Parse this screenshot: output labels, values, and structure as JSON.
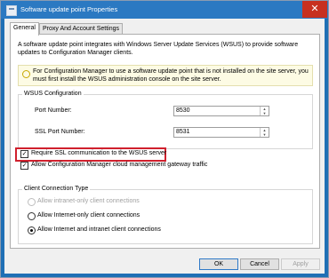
{
  "window": {
    "title": "Software update point Properties",
    "close_glyph": "✕"
  },
  "tabs": [
    {
      "label": "General",
      "active": true
    },
    {
      "label": "Proxy And Account Settings",
      "active": false
    }
  ],
  "general": {
    "intro": "A software update point integrates with Windows Server Update Services (WSUS) to provide software updates to Configuration Manager clients.",
    "info": "For Configuration Manager to use a software update point that is not installed on the site server, you must first install the WSUS administration console on the site server.",
    "wsus_group": {
      "title": "WSUS Configuration",
      "port_label": "Port Number:",
      "port_value": "8530",
      "ssl_port_label": "SSL Port Number:",
      "ssl_port_value": "8531"
    },
    "require_ssl": {
      "label": "Require SSL communication to the WSUS server",
      "checked": true
    },
    "allow_cmg": {
      "label": "Allow Configuration Manager cloud management gateway traffic",
      "checked": true
    },
    "connection_group": {
      "title": "Client Connection Type",
      "options": [
        {
          "label": "Allow intranet-only client connections",
          "selected": false,
          "disabled": true
        },
        {
          "label": "Allow Internet-only client connections",
          "selected": false,
          "disabled": false
        },
        {
          "label": "Allow Internet and intranet client connections",
          "selected": true,
          "disabled": false
        }
      ]
    }
  },
  "buttons": {
    "ok": "OK",
    "cancel": "Cancel",
    "apply": "Apply"
  },
  "colors": {
    "titlebar": "#2b79c2",
    "close": "#c7301f",
    "highlight": "#d0202d"
  }
}
